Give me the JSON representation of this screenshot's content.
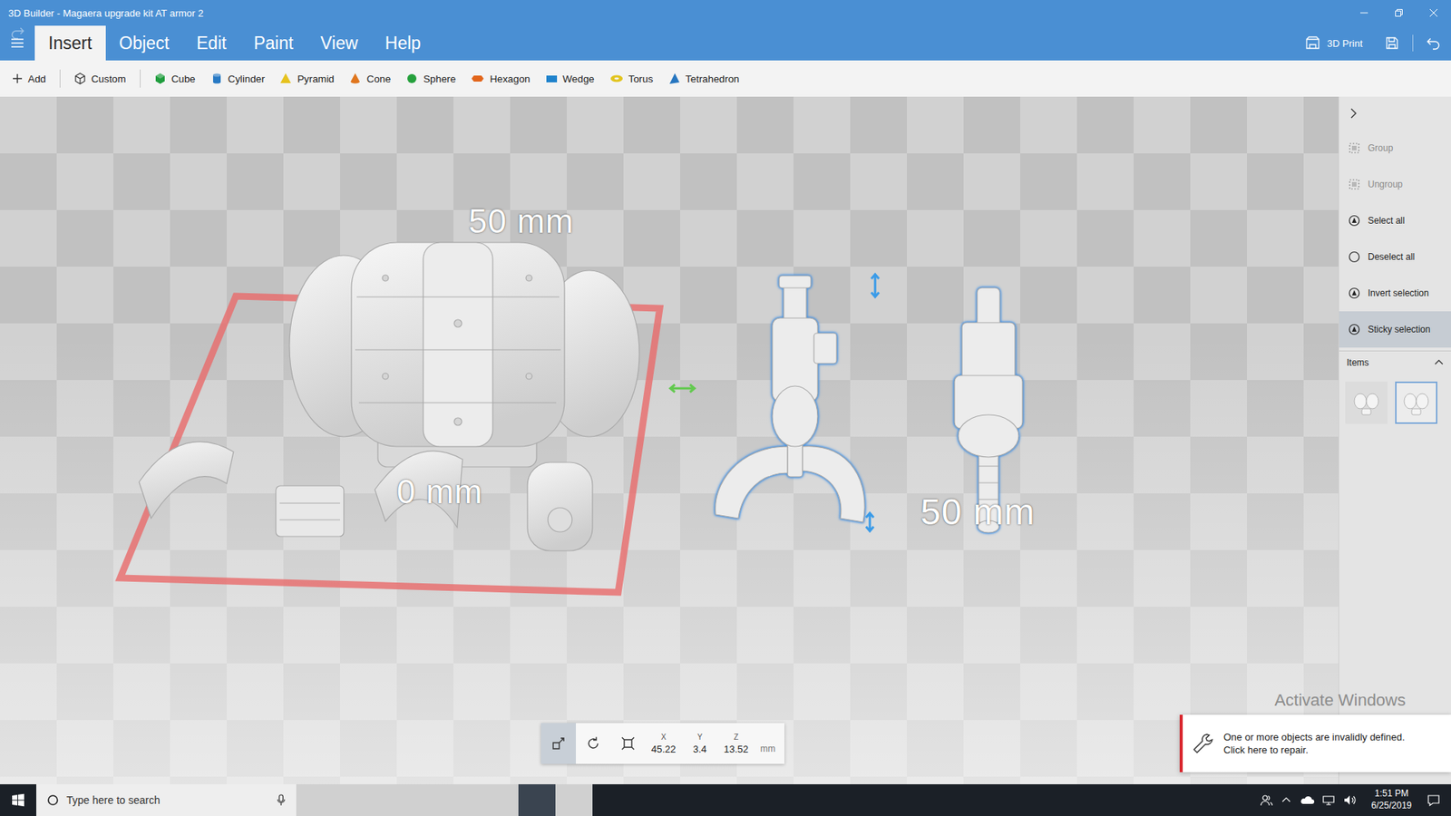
{
  "window": {
    "title": "3D Builder - Magaera upgrade kit AT armor 2"
  },
  "ribbon": {
    "tabs": [
      {
        "label": "Insert",
        "selected": true
      },
      {
        "label": "Object",
        "selected": false
      },
      {
        "label": "Edit",
        "selected": false
      },
      {
        "label": "Paint",
        "selected": false
      },
      {
        "label": "View",
        "selected": false
      },
      {
        "label": "Help",
        "selected": false
      }
    ],
    "print_label": "3D Print",
    "undo_disabled": false,
    "redo_disabled": true
  },
  "toolbar": {
    "items": [
      {
        "label": "Add",
        "kind": "add",
        "color": "#333333"
      },
      {
        "label": "Custom",
        "kind": "custom",
        "color": "#333333"
      },
      {
        "label": "Cube",
        "kind": "cube",
        "color": "#1f9d3d"
      },
      {
        "label": "Cylinder",
        "kind": "cylinder",
        "color": "#2779c4"
      },
      {
        "label": "Pyramid",
        "kind": "pyramid",
        "color": "#e6c21e"
      },
      {
        "label": "Cone",
        "kind": "cone",
        "color": "#e0761e"
      },
      {
        "label": "Sphere",
        "kind": "sphere",
        "color": "#25a03c"
      },
      {
        "label": "Hexagon",
        "kind": "hexagon",
        "color": "#e2651a"
      },
      {
        "label": "Wedge",
        "kind": "wedge",
        "color": "#1f82cc"
      },
      {
        "label": "Torus",
        "kind": "torus",
        "color": "#e2c41e"
      },
      {
        "label": "Tetrahedron",
        "kind": "tetrahedron",
        "color": "#2676c0"
      }
    ]
  },
  "scene": {
    "objects": [
      {
        "kind": "armor",
        "selected": false,
        "flagged": true
      },
      {
        "kind": "claw",
        "selected": true,
        "flagged": false
      },
      {
        "kind": "gun",
        "selected": true,
        "flagged": false
      }
    ],
    "dimension_labels": [
      "50 mm",
      "0 mm",
      "50 mm"
    ]
  },
  "transform": {
    "tools": [
      {
        "kind": "move",
        "selected": true
      },
      {
        "kind": "rotate",
        "selected": false
      },
      {
        "kind": "scale",
        "selected": false
      }
    ],
    "fields": [
      {
        "axis": "X",
        "value": "45.22"
      },
      {
        "axis": "Y",
        "value": "3.4"
      },
      {
        "axis": "Z",
        "value": "13.52"
      }
    ],
    "unit": "mm"
  },
  "side_panel": {
    "actions": [
      {
        "label": "Group",
        "kind": "group",
        "disabled": true,
        "selected": false
      },
      {
        "label": "Ungroup",
        "kind": "ungroup",
        "disabled": true,
        "selected": false
      },
      {
        "label": "Select all",
        "kind": "select-all",
        "disabled": false,
        "selected": false
      },
      {
        "label": "Deselect all",
        "kind": "deselect-all",
        "disabled": false,
        "selected": false
      },
      {
        "label": "Invert selection",
        "kind": "invert",
        "disabled": false,
        "selected": false
      },
      {
        "label": "Sticky selection",
        "kind": "sticky",
        "disabled": false,
        "selected": true
      }
    ],
    "items_title": "Items",
    "items": [
      {
        "selected": false
      },
      {
        "selected": true
      }
    ]
  },
  "notification": {
    "message": "One or more objects are invalidly defined.",
    "action": "Click here to repair."
  },
  "watermark": "Activate Windows",
  "taskbar": {
    "search_placeholder": "Type here to search",
    "apps": [
      {
        "kind": "task-view",
        "running": false,
        "active": false
      },
      {
        "kind": "edge",
        "running": false,
        "active": false
      },
      {
        "kind": "explorer",
        "running": false,
        "active": false
      },
      {
        "kind": "store",
        "running": false,
        "active": false
      },
      {
        "kind": "mail",
        "running": false,
        "active": false
      },
      {
        "kind": "discord",
        "running": false,
        "active": false
      },
      {
        "kind": "3d-builder",
        "running": true,
        "active": true
      },
      {
        "kind": "chrome",
        "running": true,
        "active": false
      }
    ],
    "time": "1:51 PM",
    "date": "6/25/2019"
  }
}
